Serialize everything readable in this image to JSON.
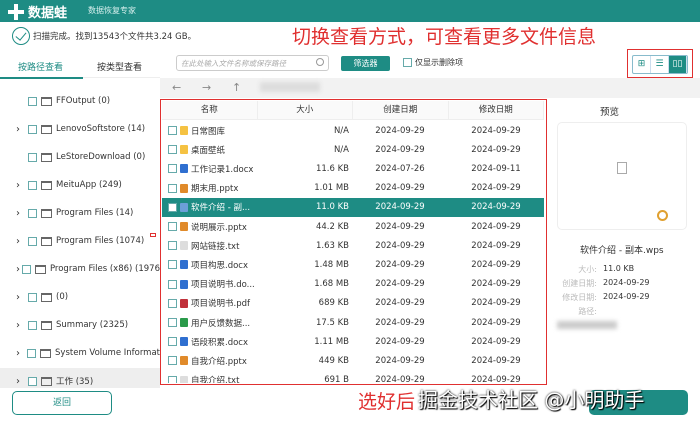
{
  "app": {
    "name": "数据蛙",
    "subtitle": "数据恢复专家",
    "brand_color": "#1e8c84"
  },
  "status": {
    "text": "扫描完成。找到13543个文件共3.24 GB。"
  },
  "tabs": [
    {
      "label": "按路径查看",
      "active": true
    },
    {
      "label": "按类型查看",
      "active": false
    }
  ],
  "toolbar": {
    "search_placeholder": "在此处输入文件名称或保存路径",
    "filter_label": "筛选器",
    "deleted_only_label": "仅显示删除项",
    "views": [
      {
        "icon": "grid-icon"
      },
      {
        "icon": "list-icon"
      },
      {
        "icon": "detail-icon",
        "active": true
      }
    ]
  },
  "sidebar": {
    "items": [
      {
        "label": "FFOutput (0)",
        "expandable": false
      },
      {
        "label": "LenovoSoftstore (14)",
        "expandable": true
      },
      {
        "label": "LeStoreDownload (0)",
        "expandable": false
      },
      {
        "label": "MeituApp (249)",
        "expandable": true
      },
      {
        "label": "Program Files (14)",
        "expandable": true
      },
      {
        "label": "Program Files (1074)",
        "expandable": true
      },
      {
        "label": "Program Files (x86) (1976",
        "expandable": true
      },
      {
        "label": "(0)",
        "expandable": true
      },
      {
        "label": "Summary (2325)",
        "expandable": true
      },
      {
        "label": "System Volume Informat",
        "expandable": true
      },
      {
        "label": "工作 (35)",
        "expandable": true,
        "highlighted": true
      }
    ]
  },
  "table": {
    "columns": [
      "名称",
      "大小",
      "创建日期",
      "修改日期"
    ],
    "rows": [
      {
        "name": "日常图库",
        "size": "N/A",
        "created": "2024-09-29",
        "modified": "2024-09-29",
        "type": "folder"
      },
      {
        "name": "桌面壁纸",
        "size": "N/A",
        "created": "2024-09-29",
        "modified": "2024-09-29",
        "type": "folder"
      },
      {
        "name": "工作记录1.docx",
        "size": "11.6 KB",
        "created": "2024-07-26",
        "modified": "2024-09-11",
        "type": "docx"
      },
      {
        "name": "期末用.pptx",
        "size": "1.01 MB",
        "created": "2024-09-29",
        "modified": "2024-09-29",
        "type": "pptx"
      },
      {
        "name": "软件介绍 - 副...",
        "size": "11.0 KB",
        "created": "2024-09-29",
        "modified": "2024-09-29",
        "type": "wps",
        "selected": true
      },
      {
        "name": "说明展示.pptx",
        "size": "44.2 KB",
        "created": "2024-09-29",
        "modified": "2024-09-29",
        "type": "pptx"
      },
      {
        "name": "网站链接.txt",
        "size": "1.63 KB",
        "created": "2024-09-29",
        "modified": "2024-09-29",
        "type": "txt"
      },
      {
        "name": "项目构思.docx",
        "size": "1.48 MB",
        "created": "2024-09-29",
        "modified": "2024-09-29",
        "type": "docx"
      },
      {
        "name": "项目说明书.do...",
        "size": "1.68 MB",
        "created": "2024-09-29",
        "modified": "2024-09-29",
        "type": "docx"
      },
      {
        "name": "项目说明书.pdf",
        "size": "689 KB",
        "created": "2024-09-29",
        "modified": "2024-09-29",
        "type": "pdf"
      },
      {
        "name": "用户反馈数据...",
        "size": "17.5 KB",
        "created": "2024-09-29",
        "modified": "2024-09-29",
        "type": "xlsx"
      },
      {
        "name": "语段积累.docx",
        "size": "1.11 MB",
        "created": "2024-09-29",
        "modified": "2024-09-29",
        "type": "docx"
      },
      {
        "name": "自我介绍.pptx",
        "size": "449 KB",
        "created": "2024-09-29",
        "modified": "2024-09-29",
        "type": "pptx"
      },
      {
        "name": "自我介绍.txt",
        "size": "691  B",
        "created": "2024-09-29",
        "modified": "2024-09-29",
        "type": "txt"
      }
    ]
  },
  "preview": {
    "title": "预览",
    "filename": "软件介绍 - 副本.wps",
    "size_label": "大小:",
    "size": "11.0 KB",
    "created_label": "创建日期:",
    "created": "2024-09-29",
    "modified_label": "修改日期:",
    "modified": "2024-09-29",
    "path_label": "路径:"
  },
  "footer": {
    "back_label": "返回"
  },
  "annotations": {
    "top": "切换查看方式，可查看更多文件信息",
    "bottom": "选好后",
    "watermark": "掘金技术社区 @小明助手",
    "color": "#e03030"
  }
}
